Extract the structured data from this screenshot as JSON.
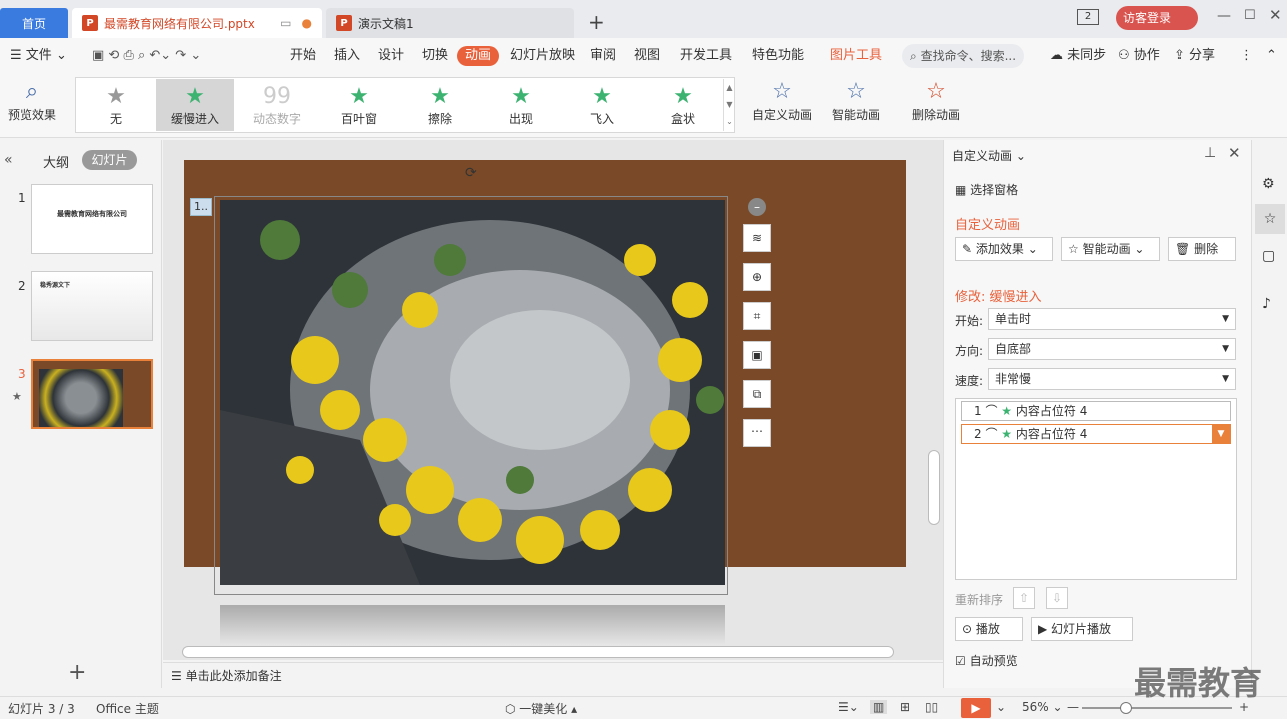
{
  "tabs": {
    "home": "首页",
    "file": "最需教育网络有限公司.pptx",
    "doc2": "演示文稿1"
  },
  "title_right": {
    "guest": "访客登录"
  },
  "menu": {
    "file": "文件",
    "items": [
      "开始",
      "插入",
      "设计",
      "切换",
      "动画",
      "幻灯片放映",
      "审阅",
      "视图",
      "开发工具",
      "特色功能",
      "图片工具"
    ],
    "active": "动画",
    "search_placeholder": "查找命令、搜索...",
    "unsync": "未同步",
    "collab": "协作",
    "share": "分享"
  },
  "ribbon": {
    "preview": "预览效果",
    "effects": [
      "无",
      "缓慢进入",
      "动态数字",
      "百叶窗",
      "擦除",
      "出现",
      "飞入",
      "盒状"
    ],
    "custom": "自定义动画",
    "smart": "智能动画",
    "delete": "删除动画"
  },
  "leftpane": {
    "tab_outline": "大纲",
    "tab_slides": "幻灯片",
    "slide1_title": "最需教育网络有限公司",
    "slide2_title": "稳秀源文下",
    "add": "+"
  },
  "slide": {
    "anim_badge": "1.."
  },
  "notes": "单击此处添加备注",
  "rightpane": {
    "header": "自定义动画",
    "select_pane": "选择窗格",
    "section_title": "自定义动画",
    "add_effect": "添加效果",
    "smart_anim": "智能动画",
    "delete": "删除",
    "modify": "修改: 缓慢进入",
    "start_label": "开始:",
    "start_value": "单击时",
    "dir_label": "方向:",
    "dir_value": "自底部",
    "speed_label": "速度:",
    "speed_value": "非常慢",
    "list": [
      {
        "num": "1",
        "name": "内容占位符 4"
      },
      {
        "num": "2",
        "name": "内容占位符 4"
      }
    ],
    "reorder": "重新排序",
    "play": "播放",
    "slideshow": "幻灯片播放",
    "autopreview": "自动预览"
  },
  "status": {
    "slide": "幻灯片 3 / 3",
    "theme": "Office 主题",
    "beautify": "一键美化",
    "zoom": "56%"
  },
  "watermark": "最需教育"
}
